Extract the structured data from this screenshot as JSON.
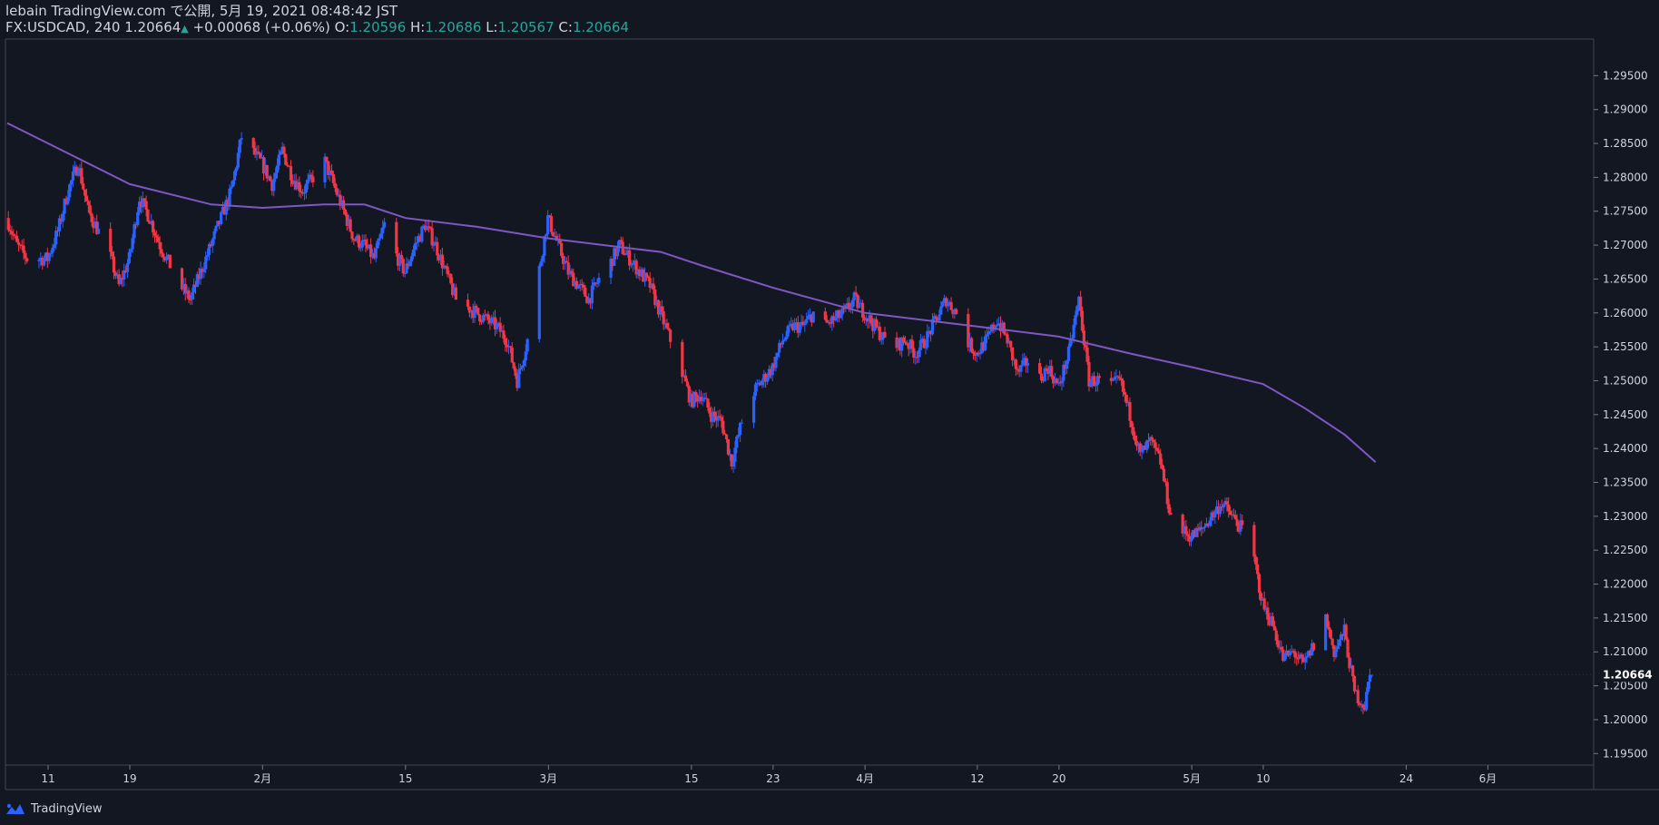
{
  "header": {
    "publisher": "lebain TradingView.com で公開, 5月 19, 2021 08:48:42 JST",
    "symbol": "FX:USDCAD, 240",
    "last": "1.20664",
    "change_arrow": "▲",
    "change": "+0.00068 (+0.06%)",
    "open_label": "O:",
    "open": "1.20596",
    "high_label": "H:",
    "high": "1.20686",
    "low_label": "L:",
    "low": "1.20567",
    "close_label": "C:",
    "close": "1.20664"
  },
  "footer": {
    "brand": "TradingView",
    "icon": "tradingview-logo-icon"
  },
  "colors": {
    "background": "#131722",
    "up": "#2962ff",
    "down": "#f23645",
    "ma": "#7e57c2",
    "text": "#d1d4dc",
    "teal": "#26a69a"
  },
  "chart_data": {
    "type": "candlestick",
    "symbol": "FX:USDCAD",
    "interval": "240",
    "last_price_label": "1.20664",
    "y_ticks": [
      "1.19500",
      "1.20000",
      "1.20500",
      "1.21000",
      "1.21500",
      "1.22000",
      "1.22500",
      "1.23000",
      "1.23500",
      "1.24000",
      "1.24500",
      "1.25000",
      "1.25500",
      "1.26000",
      "1.26500",
      "1.27000",
      "1.27500",
      "1.28000",
      "1.28500",
      "1.29000",
      "1.29500"
    ],
    "y_range": [
      1.1937,
      1.3
    ],
    "x_range_days": [
      "2021-01-07",
      "2021-06-11"
    ],
    "x_ticks": [
      {
        "label": "11",
        "date": "2021-01-11"
      },
      {
        "label": "19",
        "date": "2021-01-19"
      },
      {
        "label": "2月",
        "date": "2021-02-01"
      },
      {
        "label": "15",
        "date": "2021-02-15"
      },
      {
        "label": "3月",
        "date": "2021-03-01"
      },
      {
        "label": "15",
        "date": "2021-03-15"
      },
      {
        "label": "23",
        "date": "2021-03-23"
      },
      {
        "label": "4月",
        "date": "2021-04-01"
      },
      {
        "label": "12",
        "date": "2021-04-12"
      },
      {
        "label": "20",
        "date": "2021-04-20"
      },
      {
        "label": "5月",
        "date": "2021-05-03"
      },
      {
        "label": "10",
        "date": "2021-05-10"
      },
      {
        "label": "24",
        "date": "2021-05-24"
      },
      {
        "label": "6月",
        "date": "2021-06-01"
      }
    ],
    "price_path": [
      [
        "2021-01-07",
        1.274
      ],
      [
        "2021-01-08",
        1.27
      ],
      [
        "2021-01-09",
        1.268
      ],
      [
        "2021-01-11",
        1.268
      ],
      [
        "2021-01-12",
        1.272
      ],
      [
        "2021-01-13",
        1.278
      ],
      [
        "2021-01-14",
        1.282
      ],
      [
        "2021-01-15",
        1.275
      ],
      [
        "2021-01-16",
        1.272
      ],
      [
        "2021-01-17",
        1.269
      ],
      [
        "2021-01-18",
        1.264
      ],
      [
        "2021-01-19",
        1.268
      ],
      [
        "2021-01-20",
        1.277
      ],
      [
        "2021-01-21",
        1.274
      ],
      [
        "2021-01-22",
        1.27
      ],
      [
        "2021-01-24",
        1.264
      ],
      [
        "2021-01-25",
        1.262
      ],
      [
        "2021-01-27",
        1.27
      ],
      [
        "2021-01-28",
        1.274
      ],
      [
        "2021-01-29",
        1.278
      ],
      [
        "2021-01-30",
        1.286
      ],
      [
        "2021-02-01",
        1.282
      ],
      [
        "2021-02-02",
        1.279
      ],
      [
        "2021-02-03",
        1.284
      ],
      [
        "2021-02-04",
        1.28
      ],
      [
        "2021-02-05",
        1.278
      ],
      [
        "2021-02-06",
        1.28
      ],
      [
        "2021-02-07",
        1.283
      ],
      [
        "2021-02-08",
        1.279
      ],
      [
        "2021-02-09",
        1.275
      ],
      [
        "2021-02-10",
        1.271
      ],
      [
        "2021-02-11",
        1.27
      ],
      [
        "2021-02-12",
        1.268
      ],
      [
        "2021-02-13",
        1.273
      ],
      [
        "2021-02-14",
        1.269
      ],
      [
        "2021-02-15",
        1.266
      ],
      [
        "2021-02-16",
        1.27
      ],
      [
        "2021-02-17",
        1.273
      ],
      [
        "2021-02-18",
        1.27
      ],
      [
        "2021-02-19",
        1.266
      ],
      [
        "2021-02-20",
        1.262
      ],
      [
        "2021-02-22",
        1.26
      ],
      [
        "2021-02-24",
        1.258
      ],
      [
        "2021-02-25",
        1.256
      ],
      [
        "2021-02-26",
        1.25
      ],
      [
        "2021-02-27",
        1.256
      ],
      [
        "2021-02-28",
        1.265
      ],
      [
        "2021-03-01",
        1.274
      ],
      [
        "2021-03-02",
        1.27
      ],
      [
        "2021-03-03",
        1.266
      ],
      [
        "2021-03-04",
        1.264
      ],
      [
        "2021-03-05",
        1.262
      ],
      [
        "2021-03-06",
        1.265
      ],
      [
        "2021-03-07",
        1.267
      ],
      [
        "2021-03-08",
        1.27
      ],
      [
        "2021-03-09",
        1.268
      ],
      [
        "2021-03-10",
        1.266
      ],
      [
        "2021-03-11",
        1.264
      ],
      [
        "2021-03-12",
        1.26
      ],
      [
        "2021-03-13",
        1.256
      ],
      [
        "2021-03-14",
        1.252
      ],
      [
        "2021-03-15",
        1.247
      ],
      [
        "2021-03-16",
        1.248
      ],
      [
        "2021-03-17",
        1.245
      ],
      [
        "2021-03-18",
        1.244
      ],
      [
        "2021-03-19",
        1.238
      ],
      [
        "2021-03-20",
        1.244
      ],
      [
        "2021-03-21",
        1.248
      ],
      [
        "2021-03-22",
        1.25
      ],
      [
        "2021-03-23",
        1.252
      ],
      [
        "2021-03-24",
        1.256
      ],
      [
        "2021-03-25",
        1.258
      ],
      [
        "2021-03-26",
        1.258
      ],
      [
        "2021-03-27",
        1.26
      ],
      [
        "2021-03-28",
        1.258
      ],
      [
        "2021-03-29",
        1.259
      ],
      [
        "2021-03-30",
        1.26
      ],
      [
        "2021-03-31",
        1.262
      ],
      [
        "2021-04-01",
        1.26
      ],
      [
        "2021-04-02",
        1.258
      ],
      [
        "2021-04-03",
        1.256
      ],
      [
        "2021-04-04",
        1.255
      ],
      [
        "2021-04-05",
        1.256
      ],
      [
        "2021-04-06",
        1.254
      ],
      [
        "2021-04-07",
        1.256
      ],
      [
        "2021-04-08",
        1.259
      ],
      [
        "2021-04-09",
        1.262
      ],
      [
        "2021-04-10",
        1.26
      ],
      [
        "2021-04-11",
        1.256
      ],
      [
        "2021-04-12",
        1.254
      ],
      [
        "2021-04-13",
        1.256
      ],
      [
        "2021-04-14",
        1.259
      ],
      [
        "2021-04-15",
        1.256
      ],
      [
        "2021-04-16",
        1.251
      ],
      [
        "2021-04-17",
        1.253
      ],
      [
        "2021-04-18",
        1.25
      ],
      [
        "2021-04-19",
        1.252
      ],
      [
        "2021-04-20",
        1.249
      ],
      [
        "2021-04-21",
        1.254
      ],
      [
        "2021-04-22",
        1.262
      ],
      [
        "2021-04-23",
        1.25
      ],
      [
        "2021-04-24",
        1.25
      ],
      [
        "2021-04-25",
        1.249
      ],
      [
        "2021-04-26",
        1.25
      ],
      [
        "2021-04-27",
        1.245
      ],
      [
        "2021-04-28",
        1.239
      ],
      [
        "2021-04-29",
        1.241
      ],
      [
        "2021-04-30",
        1.238
      ],
      [
        "2021-05-01",
        1.23
      ],
      [
        "2021-05-02",
        1.228
      ],
      [
        "2021-05-03",
        1.227
      ],
      [
        "2021-05-04",
        1.228
      ],
      [
        "2021-05-05",
        1.23
      ],
      [
        "2021-05-06",
        1.232
      ],
      [
        "2021-05-07",
        1.23
      ],
      [
        "2021-05-08",
        1.228
      ],
      [
        "2021-05-09",
        1.225
      ],
      [
        "2021-05-10",
        1.217
      ],
      [
        "2021-05-11",
        1.214
      ],
      [
        "2021-05-12",
        1.209
      ],
      [
        "2021-05-13",
        1.21
      ],
      [
        "2021-05-14",
        1.208
      ],
      [
        "2021-05-15",
        1.211
      ],
      [
        "2021-05-16",
        1.216
      ],
      [
        "2021-05-17",
        1.21
      ],
      [
        "2021-05-18",
        1.213
      ],
      [
        "2021-05-19",
        1.204
      ],
      [
        "2021-05-20",
        1.202
      ],
      [
        "2021-05-20T12:00",
        1.2066
      ]
    ],
    "ma_path": [
      [
        "2021-01-07",
        1.288
      ],
      [
        "2021-01-11",
        1.285
      ],
      [
        "2021-01-19",
        1.279
      ],
      [
        "2021-01-27",
        1.276
      ],
      [
        "2021-02-01",
        1.2755
      ],
      [
        "2021-02-07",
        1.276
      ],
      [
        "2021-02-11",
        1.276
      ],
      [
        "2021-02-15",
        1.274
      ],
      [
        "2021-02-22",
        1.2727
      ],
      [
        "2021-03-01",
        1.271
      ],
      [
        "2021-03-08",
        1.2697
      ],
      [
        "2021-03-12",
        1.269
      ],
      [
        "2021-03-16",
        1.267
      ],
      [
        "2021-03-23",
        1.2637
      ],
      [
        "2021-04-01",
        1.26
      ],
      [
        "2021-04-12",
        1.258
      ],
      [
        "2021-04-20",
        1.2565
      ],
      [
        "2021-04-27",
        1.254
      ],
      [
        "2021-05-03",
        1.252
      ],
      [
        "2021-05-10",
        1.2495
      ],
      [
        "2021-05-14",
        1.246
      ],
      [
        "2021-05-18",
        1.242
      ],
      [
        "2021-05-21",
        1.238
      ]
    ]
  }
}
